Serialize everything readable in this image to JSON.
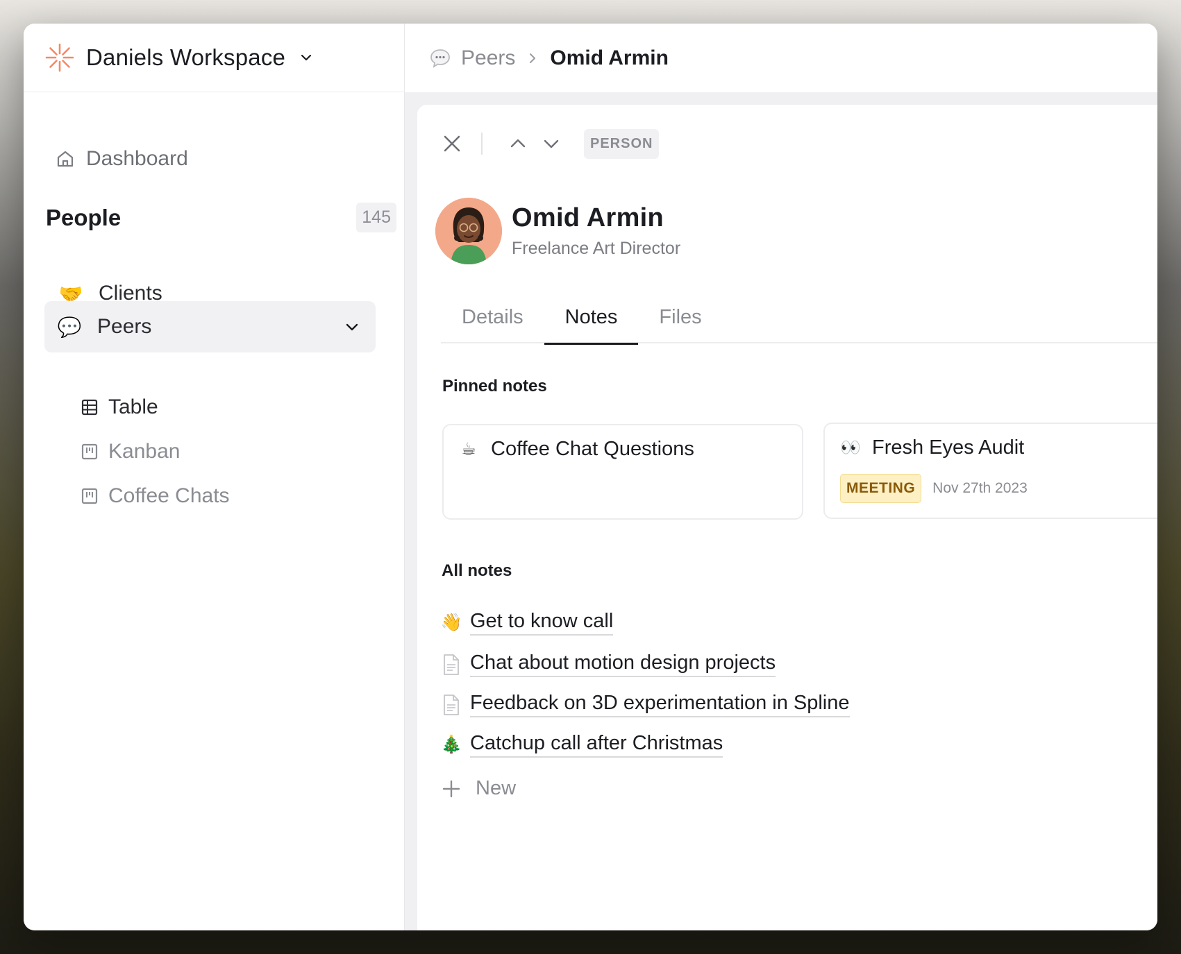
{
  "workspace": {
    "name": "Daniels Workspace",
    "logo_color": "#f28a66"
  },
  "sidebar": {
    "dashboard_label": "Dashboard",
    "section_title": "People",
    "section_count": "145",
    "items": [
      {
        "label": "Clients",
        "icon": "handshake-emoji",
        "emoji": "🤝"
      },
      {
        "label": "Peers",
        "icon": "speech-bubble-emoji",
        "emoji": "💬"
      }
    ],
    "sub_items": [
      {
        "label": "Table",
        "icon": "table-icon"
      },
      {
        "label": "Kanban",
        "icon": "kanban-icon"
      },
      {
        "label": "Coffee Chats",
        "icon": "kanban-icon"
      }
    ]
  },
  "breadcrumb": {
    "parent": "Peers",
    "current": "Omid Armin"
  },
  "toolbar": {
    "type_label": "PERSON"
  },
  "person": {
    "name": "Omid Armin",
    "role": "Freelance Art Director",
    "avatar_bg": "#f4a88a"
  },
  "tabs": [
    "Details",
    "Notes",
    "Files"
  ],
  "active_tab": "Notes",
  "pinned": {
    "label": "Pinned notes",
    "cards": [
      {
        "title": "Coffee Chat Questions",
        "emoji": "☕"
      },
      {
        "title": "Fresh Eyes Audit",
        "emoji": "👀",
        "tag": "MEETING",
        "date": "Nov 27th 2023"
      }
    ]
  },
  "all_notes": {
    "label": "All notes",
    "items": [
      {
        "title": "Get to know call",
        "emoji": "👋"
      },
      {
        "title": "Chat about motion design projects",
        "icon": "document-icon"
      },
      {
        "title": "Feedback on 3D experimentation in Spline",
        "icon": "document-icon"
      },
      {
        "title": "Catchup call after Christmas",
        "emoji": "🎄"
      }
    ],
    "new_label": "New"
  }
}
